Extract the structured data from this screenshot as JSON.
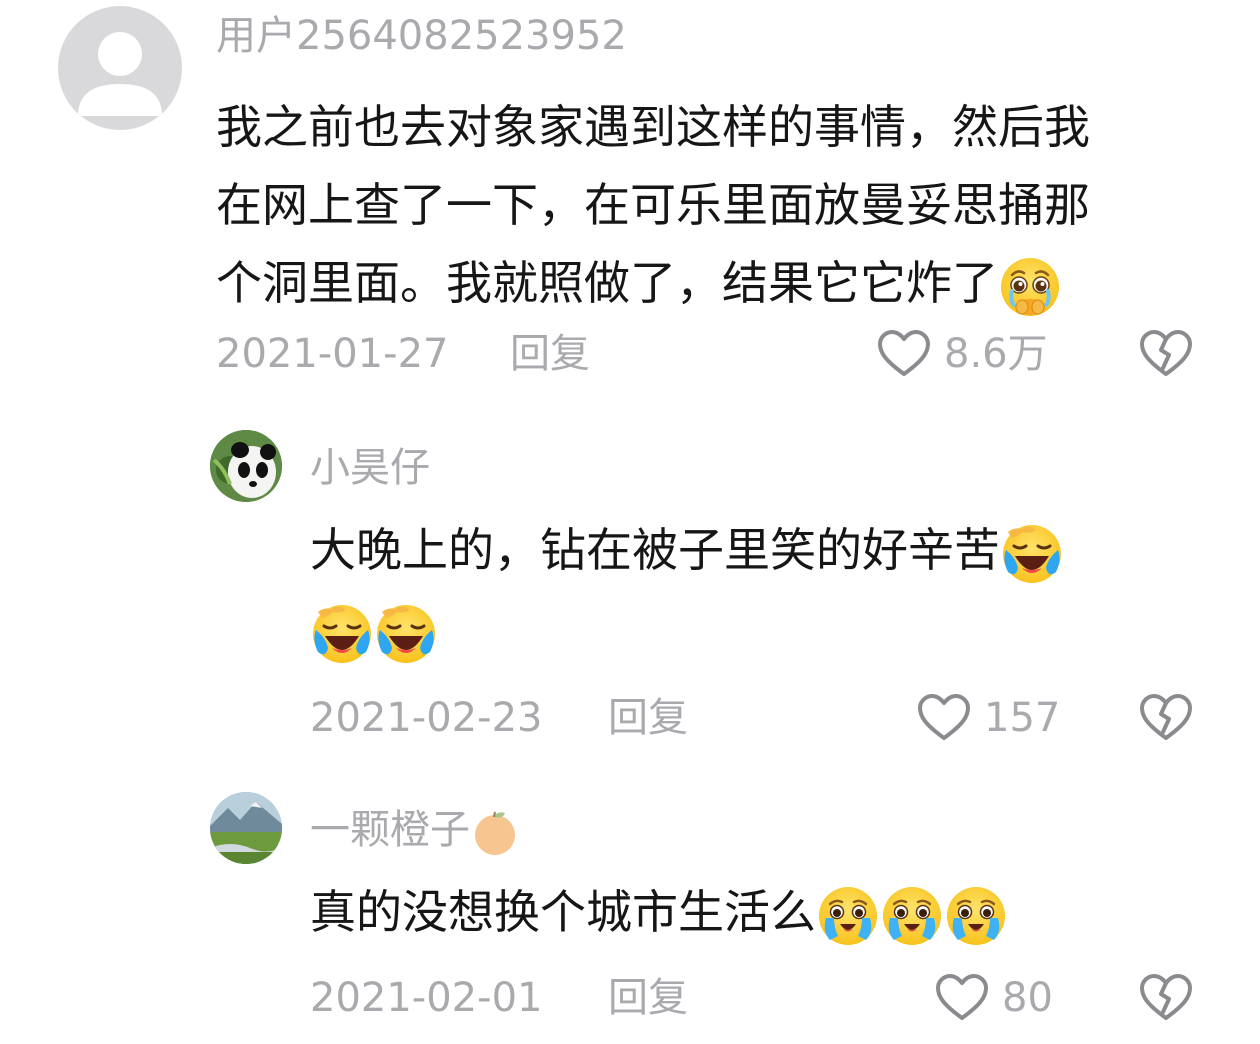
{
  "comments": [
    {
      "username": "用户2564082523952",
      "content": "我之前也去对象家遇到这样的事情，然后我在网上查了一下，在可乐里面放曼妥思捅那个洞里面。我就照做了，结果它它炸了",
      "line1": "我之前也去对象家遇到这样的事情，然后我",
      "line2": "在网上查了一下，在可乐里面放曼妥思捅那",
      "line3": "个洞里面。我就照做了，结果它它炸了",
      "emoji": "pleading-crying-face",
      "date": "2021-01-27",
      "reply": "回复",
      "likes": "8.6万",
      "avatar": "default-user-avatar"
    },
    {
      "username": "小昊仔",
      "line1": "大晚上的，钻在被子里笑的好辛苦",
      "emoji": "laughing-crying-face",
      "emoji_count_line2": 2,
      "date": "2021-02-23",
      "reply": "回复",
      "likes": "157",
      "avatar": "panda-avatar"
    },
    {
      "username": "一颗橙子",
      "username_emoji": "orange",
      "line1": "真的没想换个城市生活么",
      "emoji": "sobbing-smile-face",
      "emoji_count": 3,
      "date": "2021-02-01",
      "reply": "回复",
      "likes": "80",
      "avatar": "landscape-avatar"
    }
  ],
  "colors": {
    "text": "#161616",
    "meta": "#a9a9ae",
    "icon": "#8a8a8f",
    "background": "#ffffff"
  }
}
